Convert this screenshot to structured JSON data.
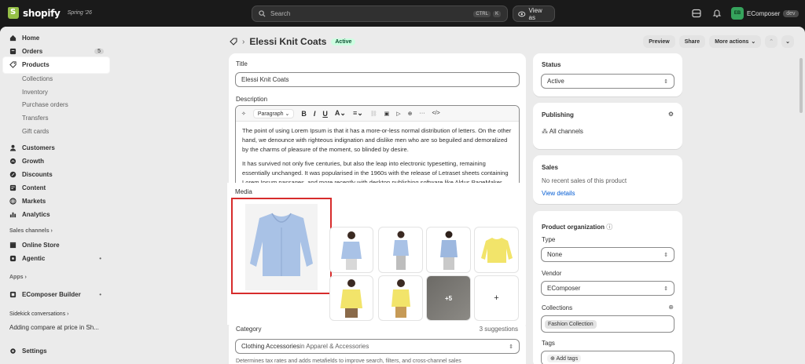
{
  "topbar": {
    "brand": "shopify",
    "season": "Spring '26",
    "search_placeholder": "Search",
    "shortcut_keys": [
      "CTRL",
      "K"
    ],
    "view_as_label": "View as",
    "account_initials": "EB",
    "account_name": "EComposer",
    "account_badge": "dev"
  },
  "sidebar": {
    "items": [
      {
        "label": "Home",
        "icon": "home-icon"
      },
      {
        "label": "Orders",
        "icon": "orders-icon",
        "count": "5"
      },
      {
        "label": "Products",
        "icon": "tag-icon"
      },
      {
        "label": "Collections"
      },
      {
        "label": "Inventory"
      },
      {
        "label": "Purchase orders"
      },
      {
        "label": "Transfers"
      },
      {
        "label": "Gift cards"
      },
      {
        "label": "Customers",
        "icon": "person-icon"
      },
      {
        "label": "Growth",
        "icon": "growth-icon"
      },
      {
        "label": "Discounts",
        "icon": "discount-icon"
      },
      {
        "label": "Content",
        "icon": "content-icon"
      },
      {
        "label": "Markets",
        "icon": "globe-icon"
      },
      {
        "label": "Analytics",
        "icon": "chart-icon"
      }
    ],
    "sales_channels_label": "Sales channels",
    "online_store": "Online Store",
    "agentic": "Agentic",
    "apps_label": "Apps",
    "ecomposer": "EComposer Builder",
    "sidekick_label": "Sidekick conversations",
    "sidekick_item": "Adding compare at price in Sh...",
    "settings": "Settings"
  },
  "header": {
    "title": "Elessi Knit Coats",
    "status_badge": "Active",
    "preview": "Preview",
    "share": "Share",
    "more_actions": "More actions"
  },
  "form": {
    "title_label": "Title",
    "title_value": "Elessi Knit Coats",
    "description_label": "Description",
    "paragraph_select": "Paragraph",
    "description_p1": "The point of using Lorem Ipsum is that it has a more-or-less normal distribution of letters. On the other hand, we denounce with righteous indignation and dislike men who are so beguiled and demoralized by the charms of pleasure of the moment, so blinded by desire.",
    "description_p2": "It has survived not only five centuries, but also the leap into electronic typesetting, remaining essentially unchanged. It was popularised in the 1960s with the release of Letraset sheets containing Lorem Ipsum passages, and more recently with desktop publishing software like Aldus PageMaker including versions of Lorem Ipsum.",
    "media_label": "Media",
    "more_media": "+5",
    "add_media": "+",
    "category_label": "Category",
    "category_suggestions": "3 suggestions",
    "category_value_main": "Clothing Accessories",
    "category_value_rest": " in Apparel & Accessories",
    "category_help": "Determines tax rates and adds metafields to improve search, filters, and cross-channel sales"
  },
  "right": {
    "status_label": "Status",
    "status_value": "Active",
    "publishing_label": "Publishing",
    "all_channels": "All channels",
    "sales_label": "Sales",
    "sales_text": "No recent sales of this product",
    "view_details": "View details",
    "org_label": "Product organization",
    "type_label": "Type",
    "type_value": "None",
    "vendor_label": "Vendor",
    "vendor_value": "EComposer",
    "collections_label": "Collections",
    "collection_chip": "Fashion Collection",
    "tags_label": "Tags",
    "add_tags": "Add tags"
  },
  "colors": {
    "topbar": "#1a1a1a",
    "frame": "#ebebeb",
    "active_badge_bg": "#cdfee1",
    "highlight_border": "#d72c2c",
    "sweater_blue": "#a9c2e6",
    "sweater_yellow": "#f2e46a"
  }
}
